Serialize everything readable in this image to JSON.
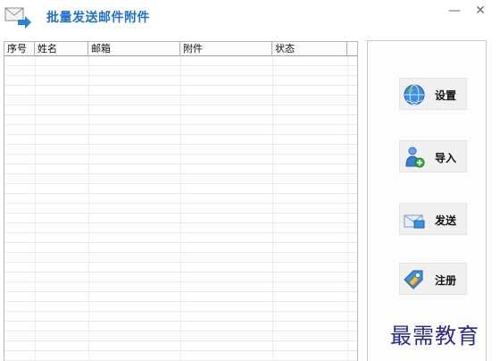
{
  "window": {
    "title": "批量发送邮件附件",
    "minimize_glyph": "—",
    "close_glyph": "✕"
  },
  "table": {
    "columns": [
      "序号",
      "姓名",
      "邮箱",
      "附件",
      "状态"
    ],
    "rows": []
  },
  "actions": {
    "settings_label": "设置",
    "import_label": "导入",
    "send_label": "发送",
    "register_label": "注册"
  },
  "watermark": "最需教育",
  "colors": {
    "title": "#1f6fc8",
    "accent_blue": "#2f7fd6"
  }
}
